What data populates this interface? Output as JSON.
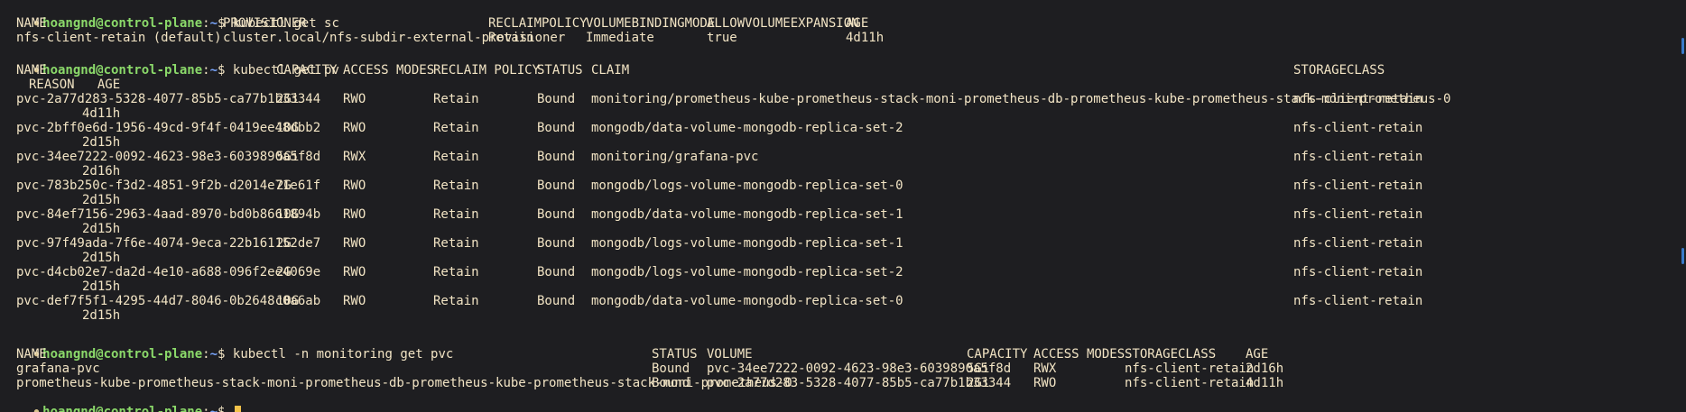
{
  "prompt": {
    "user_host": "hoangnd@control-plane",
    "sep": ":",
    "path": "~",
    "symbol": "$"
  },
  "blocks": {
    "sc": {
      "command": "kubectl get sc",
      "headers": [
        "NAME",
        "PROVISIONER",
        "RECLAIMPOLICY",
        "VOLUMEBINDINGMODE",
        "ALLOWVOLUMEEXPANSION",
        "AGE"
      ],
      "rows": [
        [
          "nfs-client-retain (default)",
          "cluster.local/nfs-subdir-external-provisioner",
          "Retain",
          "Immediate",
          "true",
          "4d11h"
        ]
      ]
    },
    "pv": {
      "command": "kubectl get pv",
      "headers": [
        "NAME",
        "CAPACITY",
        "ACCESS MODES",
        "RECLAIM POLICY",
        "STATUS",
        "CLAIM",
        "STORAGECLASS"
      ],
      "headers_wrapped": "REASON   AGE",
      "rows": [
        {
          "name": "pvc-2a77d283-5328-4077-85b5-ca77b1b33344",
          "capacity": "2Gi",
          "modes": "RWO",
          "policy": "Retain",
          "status": "Bound",
          "claim": "monitoring/prometheus-kube-prometheus-stack-moni-prometheus-db-prometheus-kube-prometheus-stack-moni-prometheus-0",
          "sc": "nfs-client-retain",
          "age": "4d11h"
        },
        {
          "name": "pvc-2bff0e6d-1956-49cd-9f4f-0419ee48dbb2",
          "capacity": "10G",
          "modes": "RWO",
          "policy": "Retain",
          "status": "Bound",
          "claim": "mongodb/data-volume-mongodb-replica-set-2",
          "sc": "nfs-client-retain",
          "age": "2d15h"
        },
        {
          "name": "pvc-34ee7222-0092-4623-98e3-6039890a5f8d",
          "capacity": "5Gi",
          "modes": "RWX",
          "policy": "Retain",
          "status": "Bound",
          "claim": "monitoring/grafana-pvc",
          "sc": "nfs-client-retain",
          "age": "2d16h"
        },
        {
          "name": "pvc-783b250c-f3d2-4851-9f2b-d2014e71e61f",
          "capacity": "2G",
          "modes": "RWO",
          "policy": "Retain",
          "status": "Bound",
          "claim": "mongodb/logs-volume-mongodb-replica-set-0",
          "sc": "nfs-client-retain",
          "age": "2d15h"
        },
        {
          "name": "pvc-84ef7156-2963-4aad-8970-bd0b8661894b",
          "capacity": "10G",
          "modes": "RWO",
          "policy": "Retain",
          "status": "Bound",
          "claim": "mongodb/data-volume-mongodb-replica-set-1",
          "sc": "nfs-client-retain",
          "age": "2d15h"
        },
        {
          "name": "pvc-97f49ada-7f6e-4074-9eca-22b161152de7",
          "capacity": "2G",
          "modes": "RWO",
          "policy": "Retain",
          "status": "Bound",
          "claim": "mongodb/logs-volume-mongodb-replica-set-1",
          "sc": "nfs-client-retain",
          "age": "2d15h"
        },
        {
          "name": "pvc-d4cb02e7-da2d-4e10-a688-096f2ee4069e",
          "capacity": "2G",
          "modes": "RWO",
          "policy": "Retain",
          "status": "Bound",
          "claim": "mongodb/logs-volume-mongodb-replica-set-2",
          "sc": "nfs-client-retain",
          "age": "2d15h"
        },
        {
          "name": "pvc-def7f5f1-4295-44d7-8046-0b2648c0a6ab",
          "capacity": "10G",
          "modes": "RWO",
          "policy": "Retain",
          "status": "Bound",
          "claim": "mongodb/data-volume-mongodb-replica-set-0",
          "sc": "nfs-client-retain",
          "age": "2d15h"
        }
      ]
    },
    "pvc": {
      "command": "kubectl -n monitoring get pvc",
      "headers": [
        "NAME",
        "STATUS",
        "VOLUME",
        "CAPACITY",
        "ACCESS MODES",
        "STORAGECLASS",
        "AGE"
      ],
      "rows": [
        [
          "grafana-pvc",
          "Bound",
          "pvc-34ee7222-0092-4623-98e3-6039890a5f8d",
          "5Gi",
          "RWX",
          "nfs-client-retain",
          "2d16h"
        ],
        [
          "prometheus-kube-prometheus-stack-moni-prometheus-db-prometheus-kube-prometheus-stack-moni-prometheus-0",
          "Bound",
          "pvc-2a77d283-5328-4077-85b5-ca77b1b33344",
          "2Gi",
          "RWO",
          "nfs-client-retain",
          "4d11h"
        ]
      ]
    },
    "final": {
      "command": ""
    }
  },
  "colors": {
    "background": "#1e1e21",
    "foreground": "#f2e4c4",
    "prompt_user": "#8bd96a",
    "prompt_path": "#7aa7ff",
    "cursor": "#f2c24a",
    "scroll_indicator": "#3a7ac8"
  }
}
